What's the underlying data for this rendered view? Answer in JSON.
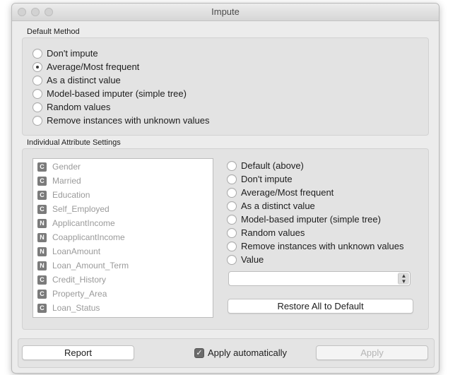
{
  "window": {
    "title": "Impute"
  },
  "default_method": {
    "title": "Default Method",
    "options": [
      {
        "label": "Don't impute",
        "checked": false
      },
      {
        "label": "Average/Most frequent",
        "checked": true
      },
      {
        "label": "As a distinct value",
        "checked": false
      },
      {
        "label": "Model-based imputer (simple tree)",
        "checked": false
      },
      {
        "label": "Random values",
        "checked": false
      },
      {
        "label": "Remove instances with unknown values",
        "checked": false
      }
    ]
  },
  "individual": {
    "title": "Individual Attribute Settings",
    "attributes": [
      {
        "type": "C",
        "name": "Gender"
      },
      {
        "type": "C",
        "name": "Married"
      },
      {
        "type": "C",
        "name": "Education"
      },
      {
        "type": "C",
        "name": "Self_Employed"
      },
      {
        "type": "N",
        "name": "ApplicantIncome"
      },
      {
        "type": "N",
        "name": "CoapplicantIncome"
      },
      {
        "type": "N",
        "name": "LoanAmount"
      },
      {
        "type": "N",
        "name": "Loan_Amount_Term"
      },
      {
        "type": "C",
        "name": "Credit_History"
      },
      {
        "type": "C",
        "name": "Property_Area"
      },
      {
        "type": "C",
        "name": "Loan_Status"
      }
    ],
    "options": [
      {
        "label": "Default (above)",
        "checked": false
      },
      {
        "label": "Don't impute",
        "checked": false
      },
      {
        "label": "Average/Most frequent",
        "checked": false
      },
      {
        "label": "As a distinct value",
        "checked": false
      },
      {
        "label": "Model-based imputer (simple tree)",
        "checked": false
      },
      {
        "label": "Random values",
        "checked": false
      },
      {
        "label": "Remove instances with unknown values",
        "checked": false
      },
      {
        "label": "Value",
        "checked": false
      }
    ],
    "value_combo": "",
    "restore_label": "Restore All to Default"
  },
  "footer": {
    "report_label": "Report",
    "apply_auto_label": "Apply automatically",
    "apply_auto_checked": true,
    "apply_label": "Apply"
  }
}
